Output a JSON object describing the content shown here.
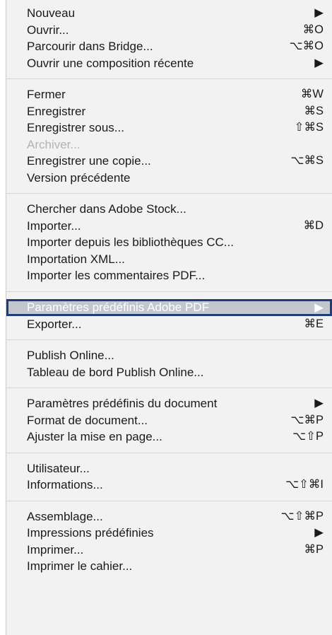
{
  "menu": {
    "groups": [
      {
        "items": [
          {
            "label": "Nouveau",
            "shortcut": "▶"
          },
          {
            "label": "Ouvrir...",
            "shortcut": "⌘O"
          },
          {
            "label": "Parcourir dans Bridge...",
            "shortcut": "⌥⌘O"
          },
          {
            "label": "Ouvrir une composition récente",
            "shortcut": "▶"
          }
        ]
      },
      {
        "items": [
          {
            "label": "Fermer",
            "shortcut": "⌘W"
          },
          {
            "label": "Enregistrer",
            "shortcut": "⌘S"
          },
          {
            "label": "Enregistrer sous...",
            "shortcut": "⇧⌘S"
          },
          {
            "label": "Archiver...",
            "shortcut": ""
          },
          {
            "label": "Enregistrer une copie...",
            "shortcut": "⌥⌘S"
          },
          {
            "label": "Version précédente",
            "shortcut": ""
          }
        ]
      },
      {
        "items": [
          {
            "label": "Chercher dans Adobe Stock...",
            "shortcut": ""
          },
          {
            "label": "Importer...",
            "shortcut": "⌘D"
          },
          {
            "label": "Importer depuis les bibliothèques CC...",
            "shortcut": ""
          },
          {
            "label": "Importation XML...",
            "shortcut": ""
          },
          {
            "label": "Importer les commentaires PDF...",
            "shortcut": ""
          }
        ]
      },
      {
        "items": [
          {
            "label": "Paramètres prédéfinis Adobe PDF",
            "shortcut": "▶"
          },
          {
            "label": "Exporter...",
            "shortcut": "⌘E"
          }
        ]
      },
      {
        "items": [
          {
            "label": "Publish Online...",
            "shortcut": ""
          },
          {
            "label": "Tableau de bord Publish Online...",
            "shortcut": ""
          }
        ]
      },
      {
        "items": [
          {
            "label": "Paramètres prédéfinis du document",
            "shortcut": "▶"
          },
          {
            "label": "Format de document...",
            "shortcut": "⌥⌘P"
          },
          {
            "label": "Ajuster la mise en page...",
            "shortcut": "⌥⇧P"
          }
        ]
      },
      {
        "items": [
          {
            "label": "Utilisateur...",
            "shortcut": ""
          },
          {
            "label": "Informations...",
            "shortcut": "⌥⇧⌘I"
          }
        ]
      },
      {
        "items": [
          {
            "label": "Assemblage...",
            "shortcut": "⌥⇧⌘P"
          },
          {
            "label": "Impressions prédéfinies",
            "shortcut": "▶"
          },
          {
            "label": "Imprimer...",
            "shortcut": "⌘P"
          },
          {
            "label": "Imprimer le cahier...",
            "shortcut": ""
          }
        ]
      }
    ]
  }
}
